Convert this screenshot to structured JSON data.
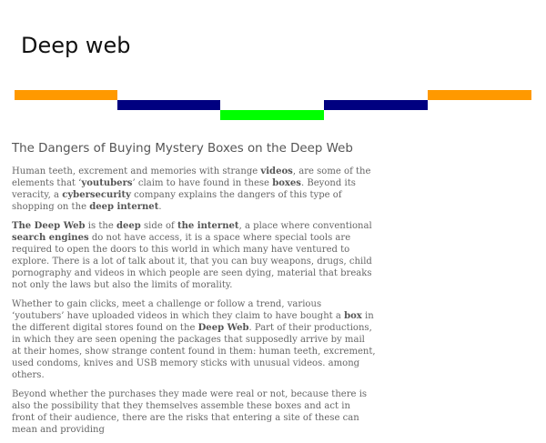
{
  "site": {
    "title": "Deep web"
  },
  "decor": {
    "colors": [
      "#ff9900",
      "#000080",
      "#00ff00",
      "#000080",
      "#ff9900"
    ]
  },
  "article": {
    "title": "The Dangers of Buying Mystery Boxes on the Deep Web",
    "paragraphs": [
      [
        {
          "t": "Human teeth, excrement and memories with strange "
        },
        {
          "t": "videos",
          "b": true
        },
        {
          "t": ", are some of the elements that ‘"
        },
        {
          "t": "youtubers",
          "b": true
        },
        {
          "t": "’ claim to have found in these "
        },
        {
          "t": "boxes",
          "b": true
        },
        {
          "t": ". Beyond its veracity, a "
        },
        {
          "t": "cybersecurity",
          "b": true
        },
        {
          "t": " company explains the dangers of this type of shopping on the "
        },
        {
          "t": "deep internet",
          "b": true
        },
        {
          "t": "."
        }
      ],
      [
        {
          "t": "The Deep Web",
          "b": true
        },
        {
          "t": " is the "
        },
        {
          "t": "deep",
          "b": true
        },
        {
          "t": " side of "
        },
        {
          "t": "the internet",
          "b": true
        },
        {
          "t": ", a place where conventional "
        },
        {
          "t": "search engines",
          "b": true
        },
        {
          "t": " do not have access, it is a space where special tools are required to open the doors to this world in which many have ventured to explore. There is a lot of talk about it, that you can buy weapons, drugs, child pornography and videos in which people are seen dying, material that breaks not only the laws but also the limits of morality."
        }
      ],
      [
        {
          "t": "Whether to gain clicks, meet a challenge or follow a trend, various ‘youtubers’ have uploaded videos in which they claim to have bought a "
        },
        {
          "t": "box",
          "b": true
        },
        {
          "t": " in the different digital stores found on the "
        },
        {
          "t": "Deep Web",
          "b": true
        },
        {
          "t": ". Part of their productions, in which they are seen opening the packages that supposedly arrive by mail at their homes, show strange content found in them: human teeth, excrement, used condoms, knives and USB memory sticks with unusual videos. among others."
        }
      ],
      [
        {
          "t": "Beyond whether the purchases they made were real or not, because there is also the possibility that they themselves assemble these boxes and act in front of their audience, there are the risks that entering a site of these can mean and providing"
        }
      ]
    ]
  }
}
